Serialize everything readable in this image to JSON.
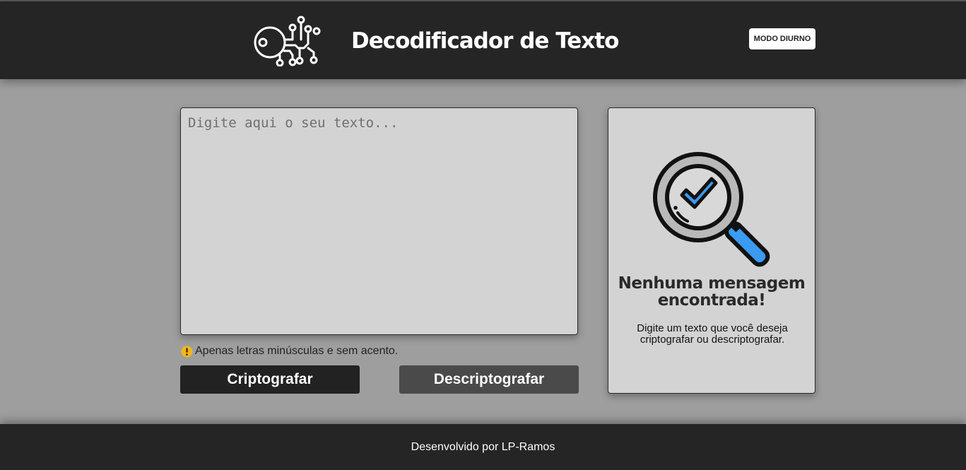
{
  "header": {
    "title": "Decodificador de Texto",
    "mode_button_label": "MODO DIURNO",
    "logo_icon": "key-circuit-icon"
  },
  "input": {
    "placeholder": "Digite aqui o seu texto...",
    "value": ""
  },
  "warning": {
    "icon": "exclamation-circle-icon",
    "text": "Apenas letras minúsculas e sem acento."
  },
  "actions": {
    "encrypt_label": "Criptografar",
    "decrypt_label": "Descriptografar"
  },
  "result": {
    "icon": "magnifier-check-icon",
    "title": "Nenhuma mensagem encontrada!",
    "text": "Digite um texto que você deseja criptografar ou descriptografar."
  },
  "footer": {
    "text": "Desenvolvido por LP-Ramos"
  },
  "colors": {
    "header_bg": "#252525",
    "page_bg": "#9e9e9e",
    "panel_bg": "#d3d3d3",
    "accent_blue": "#3a9bf0",
    "warning_yellow": "#f2b71a"
  }
}
